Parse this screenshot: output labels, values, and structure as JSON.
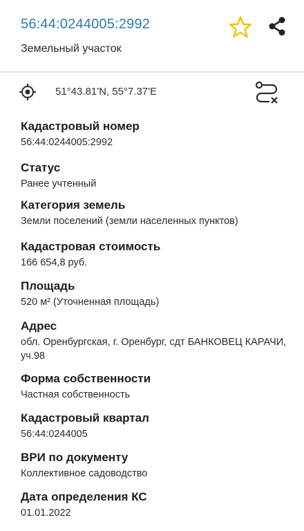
{
  "header": {
    "cadastral_title": "56:44:0244005:2992",
    "subtitle": "Земельный участок"
  },
  "location": {
    "coordinates": "51°43.81'N, 55°7.37'E"
  },
  "icons": {
    "star": "star-icon",
    "share": "share-icon",
    "location": "location-target-icon",
    "route": "route-icon"
  },
  "colors": {
    "accent": "#2f7bb3",
    "star": "#f2c400"
  },
  "fields": [
    {
      "label": "Кадастровый номер",
      "value": "56:44:0244005:2992"
    },
    {
      "label": "Статус",
      "value": "Ранее учтенный"
    },
    {
      "label": "Категория земель",
      "value": "Земли поселений (земли населенных пунктов)"
    },
    {
      "label": "Кадастровая стоимость",
      "value": "166 654,8 руб."
    },
    {
      "label": "Площадь",
      "value": "520 м² (Уточненная площадь)"
    },
    {
      "label": "Адрес",
      "value": "обл. Оренбургская, г. Оренбург, сдт БАНКОВЕЦ КАРАЧИ, уч.98"
    },
    {
      "label": "Форма собственности",
      "value": "Частная собственность"
    },
    {
      "label": "Кадастровый квартал",
      "value": "56:44:0244005"
    },
    {
      "label": "ВРИ по документу",
      "value": "Коллективное садоводство"
    },
    {
      "label": "Дата определения КС",
      "value": "01.01.2022"
    }
  ]
}
